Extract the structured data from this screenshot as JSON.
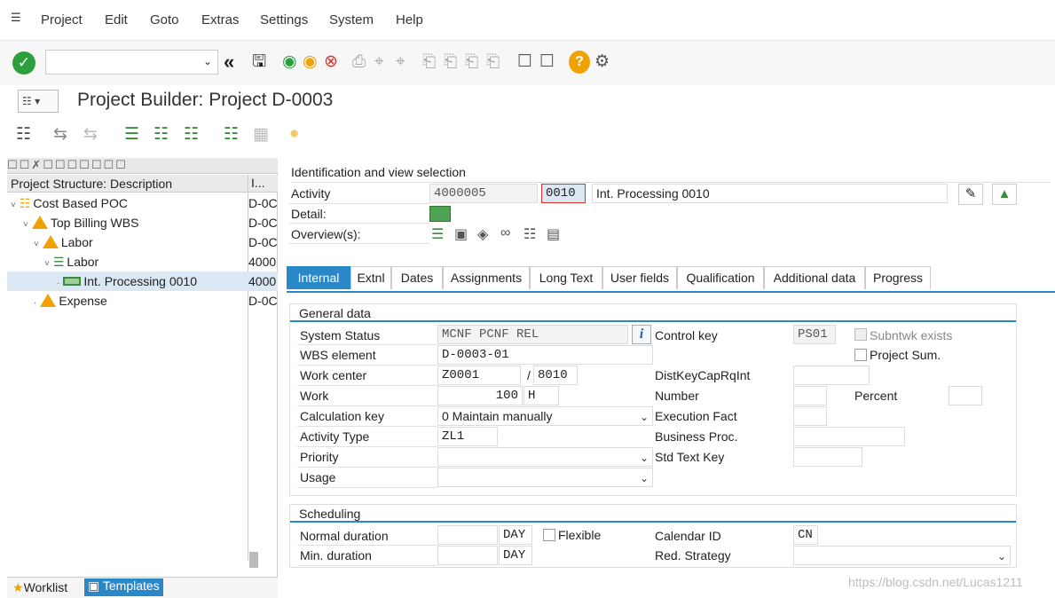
{
  "menu": {
    "items": [
      "Project",
      "Edit",
      "Goto",
      "Extras",
      "Settings",
      "System",
      "Help"
    ]
  },
  "title": "Project Builder: Project D-0003",
  "structure": {
    "header_col1": "Project Structure: Description",
    "header_col2": "I...",
    "rows": [
      {
        "label": "Cost Based POC",
        "id": "D-0C"
      },
      {
        "label": "Top Billing WBS",
        "id": "D-0C"
      },
      {
        "label": "Labor",
        "id": "D-0C"
      },
      {
        "label": "Labor",
        "id": "4000"
      },
      {
        "label": "Int. Processing 0010",
        "id": "4000"
      },
      {
        "label": "Expense",
        "id": "D-0C"
      }
    ],
    "footer_worklist": "Worklist",
    "footer_templates": "Templates"
  },
  "identification": {
    "section_title": "Identification and view selection",
    "activity_label": "Activity",
    "activity_network": "4000005",
    "activity_number": "0010",
    "activity_desc": "Int. Processing 0010",
    "detail_label": "Detail:",
    "overview_label": "Overview(s):"
  },
  "tabs": [
    "Internal",
    "Extnl",
    "Dates",
    "Assignments",
    "Long Text",
    "User fields",
    "Qualification",
    "Additional data",
    "Progress"
  ],
  "general": {
    "section_title": "General data",
    "system_status_label": "System Status",
    "system_status": "MCNF PCNF REL",
    "wbs_label": "WBS element",
    "wbs": "D-0003-01",
    "work_center_label": "Work center",
    "work_center": "Z0001",
    "plant": "8010",
    "work_label": "Work",
    "work": "100",
    "work_unit": "H",
    "calc_key_label": "Calculation key",
    "calc_key": "0 Maintain manually",
    "activity_type_label": "Activity Type",
    "activity_type": "ZL1",
    "priority_label": "Priority",
    "priority": "",
    "usage_label": "Usage",
    "usage": "",
    "control_key_label": "Control key",
    "control_key": "PS01",
    "subntwk_label": "Subntwk exists",
    "project_sum_label": "Project Sum.",
    "distkey_label": "DistKeyCapRqInt",
    "number_label": "Number",
    "percent_label": "Percent",
    "execution_label": "Execution Fact",
    "business_label": "Business Proc.",
    "std_text_label": "Std Text Key"
  },
  "scheduling": {
    "section_title": "Scheduling",
    "normal_duration_label": "Normal duration",
    "normal_unit": "DAY",
    "flexible_label": "Flexible",
    "min_duration_label": "Min. duration",
    "min_unit": "DAY",
    "calendar_label": "Calendar ID",
    "calendar": "CN",
    "red_strategy_label": "Red. Strategy"
  },
  "watermark": "https://blog.csdn.net/Lucas1211"
}
